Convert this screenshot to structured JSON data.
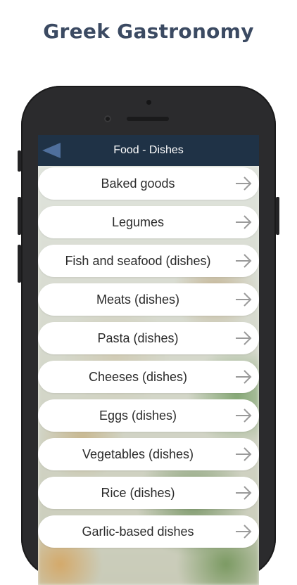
{
  "promo": {
    "title": "Greek Gastronomy"
  },
  "header": {
    "title": "Food - Dishes",
    "back_icon": "back-triangle-icon"
  },
  "categories": [
    {
      "label": "Baked goods"
    },
    {
      "label": "Legumes"
    },
    {
      "label": "Fish and seafood (dishes)"
    },
    {
      "label": "Meats (dishes)"
    },
    {
      "label": "Pasta (dishes)"
    },
    {
      "label": "Cheeses (dishes)"
    },
    {
      "label": "Eggs (dishes)"
    },
    {
      "label": "Vegetables (dishes)"
    },
    {
      "label": "Rice (dishes)"
    },
    {
      "label": "Garlic-based dishes"
    }
  ],
  "colors": {
    "nav_bar": "#1f3246",
    "back_icon": "#4f6f9c",
    "arrow_icon": "#9a9a9a",
    "promo_title": "#3b4a62"
  }
}
